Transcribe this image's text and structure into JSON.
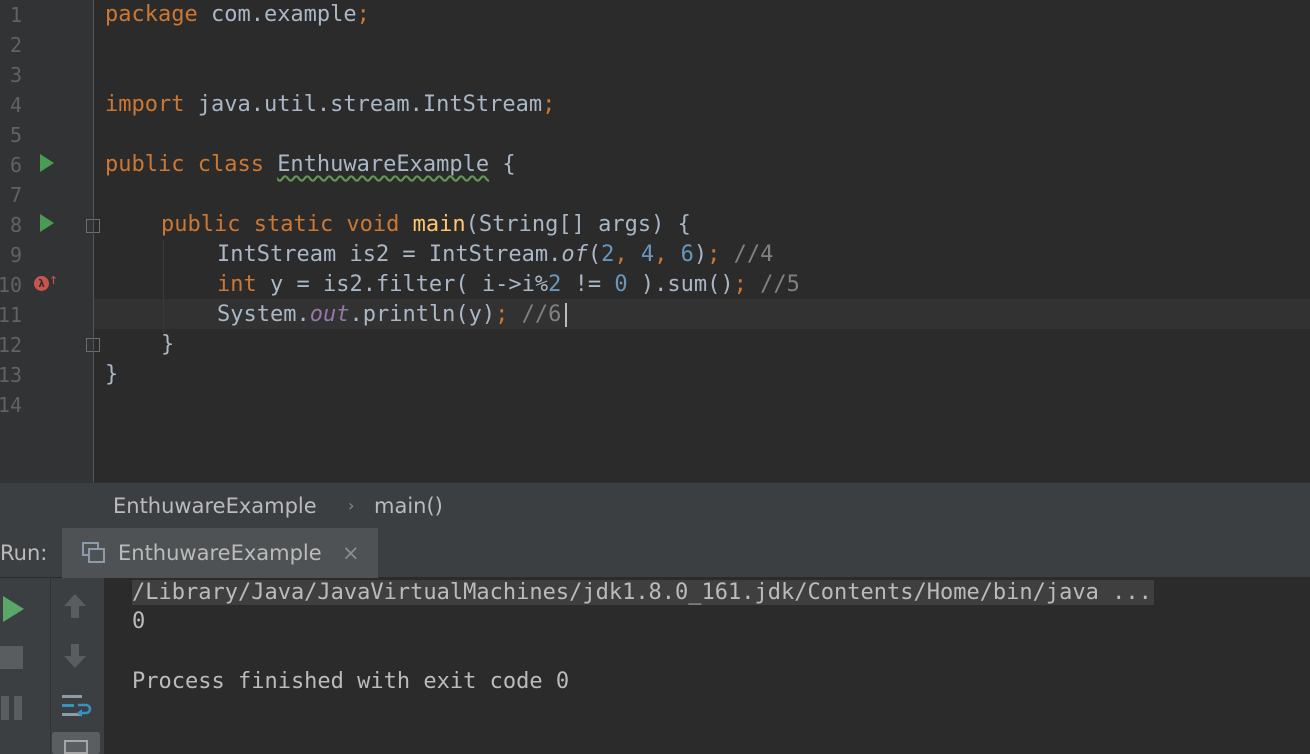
{
  "editor": {
    "line_numbers": [
      "1",
      "2",
      "3",
      "4",
      "5",
      "6",
      "7",
      "8",
      "9",
      "10",
      "11",
      "12",
      "13",
      "14"
    ],
    "code": {
      "l1_kw": "package",
      "l1_rest": " com.example",
      "l1_semi": ";",
      "l4_kw": "import",
      "l4_rest": " java.util.stream.IntStream",
      "l4_semi": ";",
      "l6_kw": "public class ",
      "l6_cls": "EnthuwareExample",
      "l6_rest": " {",
      "l8_kw": "public static void ",
      "l8_fn": "main",
      "l8_rest": "(String[] args) {",
      "l9_a": "IntStream is2 = IntStream.",
      "l9_of": "of",
      "l9_paren": "(",
      "l9_n1": "2",
      "l9_c1": ", ",
      "l9_n2": "4",
      "l9_c2": ", ",
      "l9_n3": "6",
      "l9_close": ")",
      "l9_semi": "; ",
      "l9_cmt": "//4",
      "l10_kw": "int",
      "l10_a": " y = is2.filter( i->i%",
      "l10_n1": "2",
      "l10_b": " != ",
      "l10_n2": "0",
      "l10_c": " ).sum()",
      "l10_semi": "; ",
      "l10_cmt": "//5",
      "l11_a": "System.",
      "l11_out": "out",
      "l11_b": ".println(y)",
      "l11_semi": "; ",
      "l11_cmt": "//6",
      "l12": "}",
      "l13": "}"
    },
    "gutter_icons": [
      "run-icon",
      "run-icon",
      "lambda-breakpoint-icon"
    ]
  },
  "breadcrumb": {
    "items": [
      "EnthuwareExample",
      "main()"
    ],
    "separator": "›"
  },
  "run_panel": {
    "label": "Run:",
    "tab_title": "EnthuwareExample",
    "tab_close": "×",
    "console_lines": [
      "/Library/Java/JavaVirtualMachines/jdk1.8.0_161.jdk/Contents/Home/bin/java ...",
      "0",
      "Process finished with exit code 0"
    ],
    "toolbar_icons": [
      "rerun-icon",
      "stop-icon",
      "pause-icon",
      "up-arrow-icon",
      "down-arrow-icon",
      "soft-wrap-icon",
      "pin-tab-icon"
    ]
  },
  "colors": {
    "background": "#2b2b2b",
    "keyword": "#cc7832",
    "method": "#ffc66d",
    "number": "#6897bb",
    "comment": "#808080",
    "static_field": "#9876aa",
    "text": "#a9b7c6"
  }
}
